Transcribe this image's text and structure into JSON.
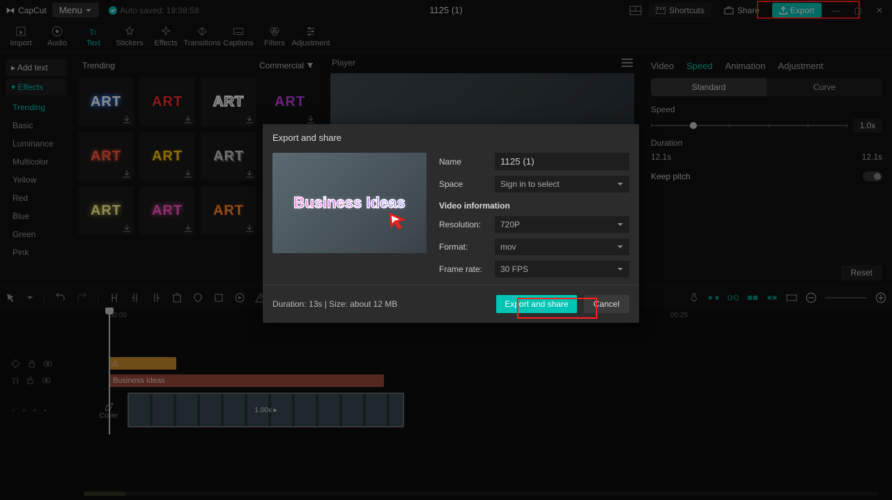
{
  "app": {
    "name": "CapCut",
    "menu": "Menu",
    "autosave": "Auto saved: 19:38:58",
    "title": "1125 (1)"
  },
  "top": {
    "shortcuts": "Shortcuts",
    "share": "Share",
    "export": "Export"
  },
  "tooltabs": [
    "Import",
    "Audio",
    "Text",
    "Stickers",
    "Effects",
    "Transitions",
    "Captions",
    "Filters",
    "Adjustment"
  ],
  "sidebar": {
    "addtext": "Add text",
    "effects": "Effects",
    "items": [
      "Trending",
      "Basic",
      "Luminance",
      "Multicolor",
      "Yellow",
      "Red",
      "Blue",
      "Green",
      "Pink"
    ]
  },
  "gallery": {
    "heading": "Trending",
    "commercial": "Commercial",
    "thumb_label": "ART"
  },
  "player": {
    "title": "Player"
  },
  "inspector": {
    "tabs": [
      "Video",
      "Speed",
      "Animation",
      "Adjustment"
    ],
    "seg": [
      "Standard",
      "Curve"
    ],
    "speed_label": "Speed",
    "speed_value": "1.0x",
    "duration_label": "Duration",
    "dur_left": "12.1s",
    "dur_right": "12.1s",
    "keep_pitch": "Keep pitch",
    "reset": "Reset"
  },
  "timeline": {
    "ruler0": "00:00",
    "ruler1": "00:25",
    "text_clip": "Business Ideas",
    "video_rate": "1.00x ▸",
    "cover": "Cover"
  },
  "modal": {
    "title": "Export and share",
    "thumb_text": "Business Ideas",
    "name_label": "Name",
    "name_value": "1125 (1)",
    "space_label": "Space",
    "space_value": "Sign in to select",
    "section": "Video information",
    "res_label": "Resolution:",
    "res_value": "720P",
    "fmt_label": "Format:",
    "fmt_value": "mov",
    "fps_label": "Frame rate:",
    "fps_value": "30 FPS",
    "footer_info": "Duration: 13s | Size: about 12 MB",
    "primary": "Export and share",
    "cancel": "Cancel"
  }
}
